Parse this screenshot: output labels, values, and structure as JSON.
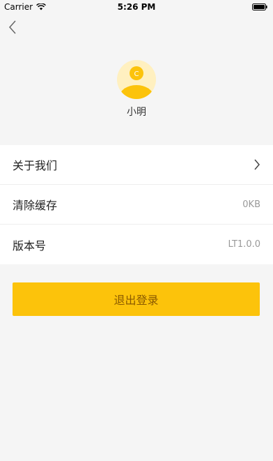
{
  "status_bar": {
    "carrier": "Carrier",
    "time": "5:26 PM"
  },
  "nav": {
    "back_icon": "chevron-left-icon"
  },
  "profile": {
    "avatar_letter": "C",
    "username": "小明",
    "avatar_colors": {
      "bg": "#fff0c0",
      "body": "#fcc30b"
    }
  },
  "settings": {
    "items": [
      {
        "label": "关于我们",
        "value": "",
        "icon": "chevron-right-icon"
      },
      {
        "label": "清除缓存",
        "value": "0KB"
      },
      {
        "label": "版本号",
        "value": "LT1.0.0"
      }
    ]
  },
  "logout": {
    "label": "退出登录",
    "color": "#fcc30b"
  }
}
